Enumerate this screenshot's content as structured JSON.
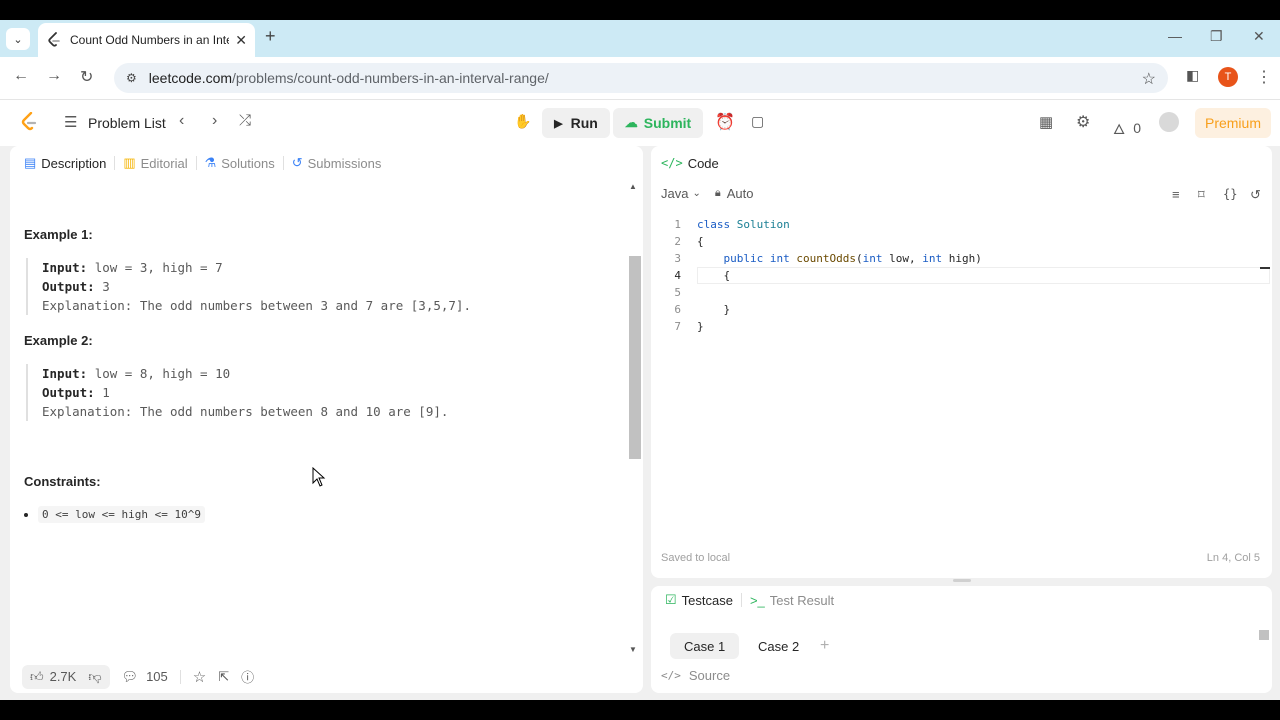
{
  "browser": {
    "tab_title": "Count Odd Numbers in an Inte",
    "url_host": "leetcode.com",
    "url_path": "/problems/count-odd-numbers-in-an-interval-range/",
    "profile_initial": "T"
  },
  "header": {
    "problem_list": "Problem List",
    "run": "Run",
    "submit": "Submit",
    "streak_count": "0",
    "premium": "Premium"
  },
  "left": {
    "tabs": [
      {
        "label": "Description"
      },
      {
        "label": "Editorial"
      },
      {
        "label": "Solutions"
      },
      {
        "label": "Submissions"
      }
    ],
    "example1": {
      "label": "Example 1:",
      "input_label": "Input:",
      "input": "low = 3, high = 7",
      "output_label": "Output:",
      "output": "3",
      "explanation_label": "Explanation:",
      "explanation": "The odd numbers between 3 and 7 are [3,5,7]."
    },
    "example2": {
      "label": "Example 2:",
      "input_label": "Input:",
      "input": "low = 8, high = 10",
      "output_label": "Output:",
      "output": "1",
      "explanation_label": "Explanation:",
      "explanation": "The odd numbers between 8 and 10 are [9]."
    },
    "constraints_label": "Constraints:",
    "constraint": "0 <= low <= high <= 10^9",
    "footer": {
      "likes": "2.7K",
      "comments": "105"
    }
  },
  "code": {
    "tab_label": "Code",
    "language": "Java",
    "mode": "Auto",
    "line_numbers": [
      "1",
      "2",
      "3",
      "4",
      "5",
      "6",
      "7"
    ],
    "saved": "Saved to local",
    "cursor": "Ln 4, Col 5"
  },
  "testcase": {
    "tab_testcase": "Testcase",
    "tab_result": "Test Result",
    "case1": "Case 1",
    "case2": "Case 2",
    "source": "Source"
  },
  "colors": {
    "accent_green": "#2db55d",
    "premium_orange": "#f89f1b",
    "keyword_blue": "#1a5cc4"
  }
}
